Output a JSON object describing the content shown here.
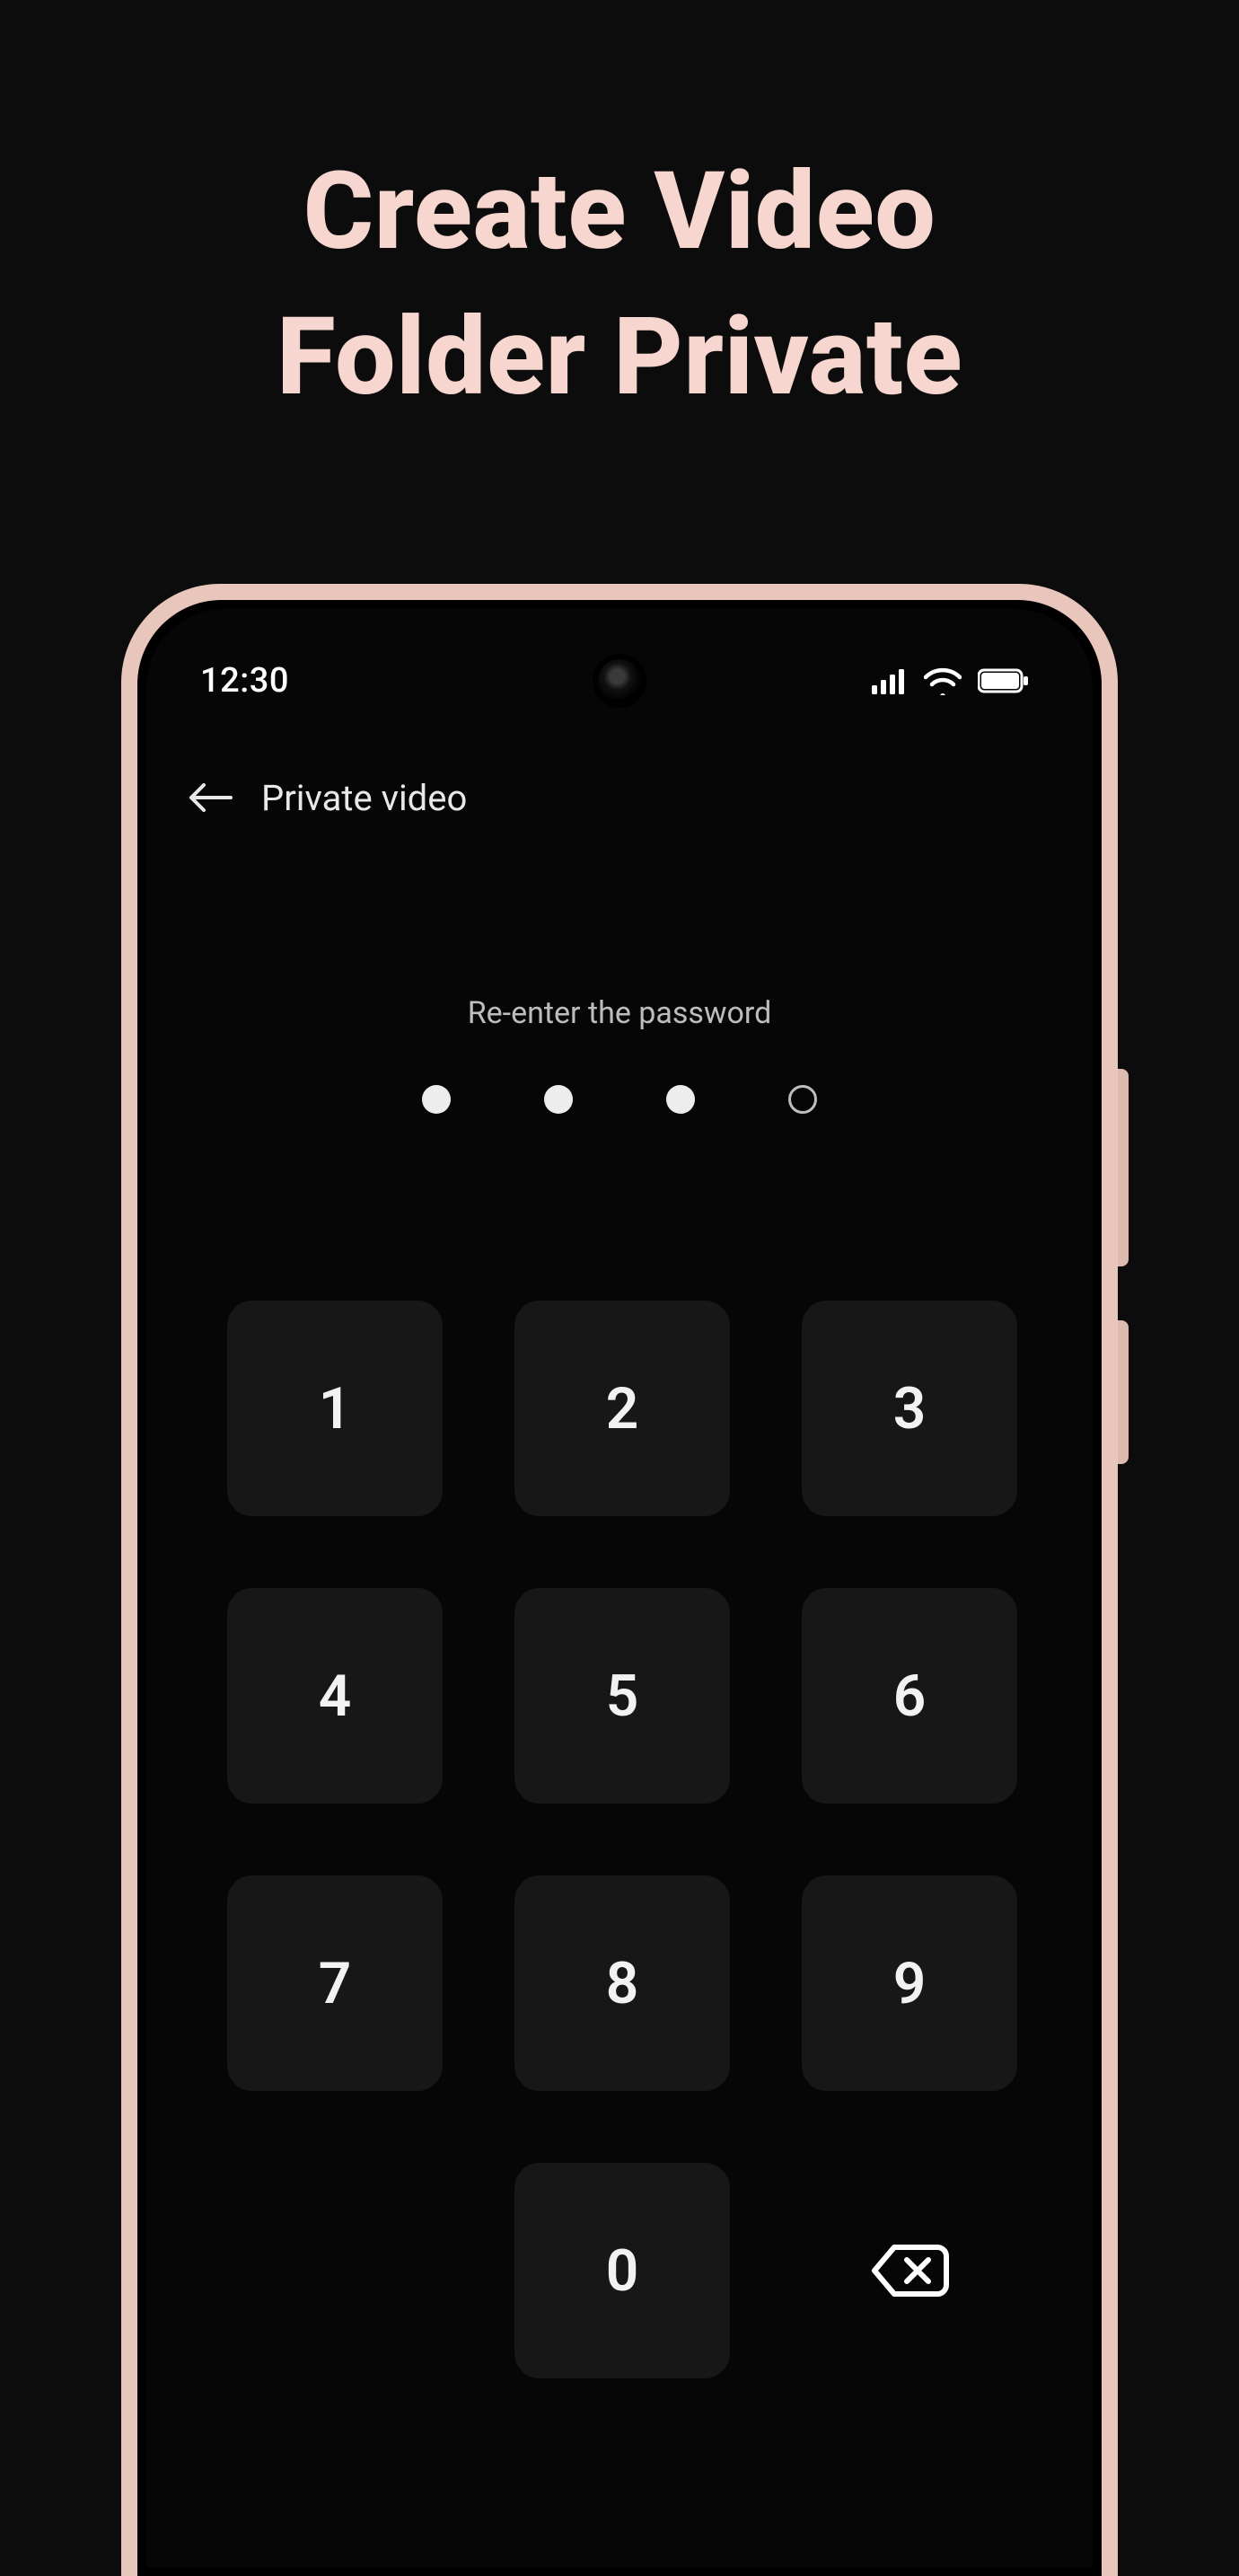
{
  "promo": {
    "line1": "Create Video",
    "line2": "Folder Private"
  },
  "status": {
    "time": "12:30"
  },
  "appbar": {
    "title": "Private video"
  },
  "lock": {
    "prompt": "Re-enter the password",
    "dots_filled": 3,
    "dots_total": 4
  },
  "keypad": {
    "k1": "1",
    "k2": "2",
    "k3": "3",
    "k4": "4",
    "k5": "5",
    "k6": "6",
    "k7": "7",
    "k8": "8",
    "k9": "9",
    "k0": "0"
  }
}
